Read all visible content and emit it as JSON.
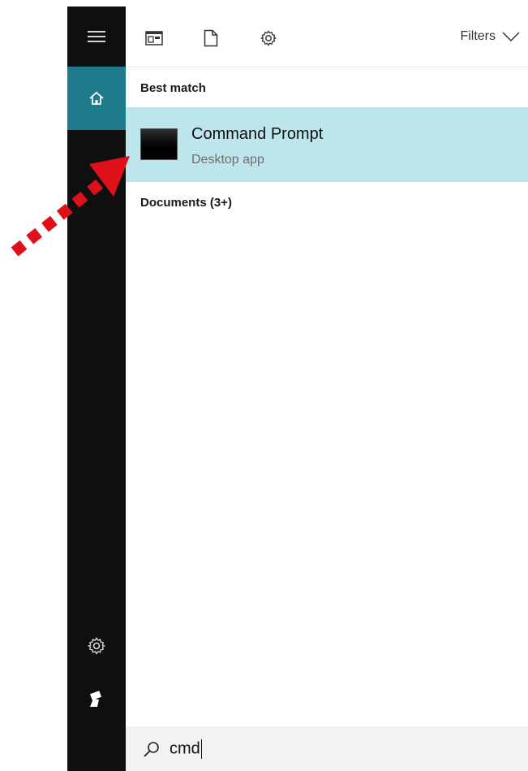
{
  "toolbar": {
    "filters_label": "Filters"
  },
  "sections": {
    "best_match_label": "Best match",
    "documents_label": "Documents (3+)"
  },
  "best_match": {
    "title": "Command Prompt",
    "subtitle": "Desktop app"
  },
  "search": {
    "query": "cmd"
  },
  "colors": {
    "rail_bg": "#0f0f0f",
    "rail_home_accent": "#1e7b8c",
    "best_match_highlight": "#bde6ec",
    "annotation_arrow": "#e0101a"
  },
  "icons": {
    "rail": [
      "hamburger-icon",
      "home-icon",
      "settings-icon",
      "user-icon"
    ],
    "toolbar": [
      "apps-icon",
      "document-icon",
      "settings-icon",
      "chevron-down-icon"
    ],
    "search": "search-icon"
  }
}
